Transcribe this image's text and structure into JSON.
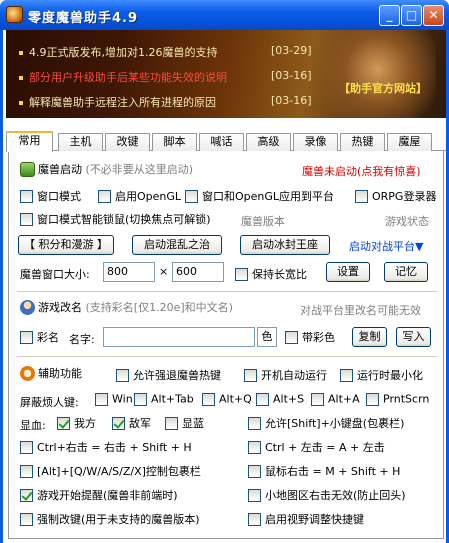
{
  "window": {
    "title": "零度魔兽助手4.9"
  },
  "banner": {
    "news": [
      {
        "text": "4.9正式版发布,增加对1.26魔兽的支持",
        "date": "[03-29]"
      },
      {
        "text": "部分用户升级助手后某些功能失效的说明",
        "date": "[03-16]"
      },
      {
        "text": "解释魔兽助手远程注入所有进程的原因",
        "date": "[03-16]"
      }
    ],
    "official_link": "【助手官方网站】"
  },
  "tabs": [
    "常用",
    "主机",
    "改键",
    "脚本",
    "喊话",
    "高级",
    "录像",
    "热键",
    "魔屋"
  ],
  "warcraft": {
    "section_title": "魔兽启动",
    "section_hint": "(不必非要从这里启动)",
    "status": "魔兽未启动(点我有惊喜)",
    "window_mode": "窗口模式",
    "opengl": "启用OpenGL",
    "window_opengl_platform": "窗口和OpenGL应用到平台",
    "orpg": "ORPG登录器",
    "smart_lock": "窗口模式智能锁鼠(切换焦点可解锁)",
    "version_label": "魔兽版本",
    "game_status_label": "游戏状态",
    "btn_ladder": "【 积分和漫游 】",
    "btn_roc": "启动混乱之治",
    "btn_tft": "启动冰封王座",
    "btn_platform": "启动对战平台▼",
    "size_label": "魔兽窗口大小:",
    "width": "800",
    "times": "×",
    "height": "600",
    "keep_ratio": "保持长宽比",
    "btn_set": "设置",
    "btn_remember": "记忆"
  },
  "rename": {
    "section_title": "游戏改名",
    "section_hint": "(支持彩名[仅1.20e]和中文名)",
    "right_hint": "对战平台里改名可能无效",
    "color_name": "彩名",
    "name_label": "名字:",
    "name_value": "",
    "color_btn": "色",
    "with_color": "带彩色",
    "btn_copy": "复制",
    "btn_write": "写入"
  },
  "aux": {
    "section_title": "辅助功能",
    "allow_hotkey": "允许强退魔兽热键",
    "auto_run": "开机自动运行",
    "minimize": "运行时最小化",
    "shield_keys_label": "屏蔽烦人键:",
    "shield_keys": [
      "Win",
      "Alt+Tab",
      "Alt+Q",
      "Alt+S",
      "Alt+A",
      "PrntScrn"
    ],
    "show_label": "显血:",
    "own": "我方",
    "enemy": "敌军",
    "show_blue": "显蓝",
    "allow_shift": "允许[Shift]+小键盘(包裹栏)",
    "ctrl_right": "Ctrl+右击 = 右击 + Shift + H",
    "ctrl_left": "Ctrl + 左击 = A + 左击",
    "alt_keys": "[Alt]+[Q/W/A/S/Z/X]控制包裹栏",
    "mouse_right": "鼠标右击 = M + Shift + H",
    "game_start_remind": "游戏开始提醒(魔兽非前端时)",
    "minimap_right": "小地图区右击无效(防止回头)",
    "force_key": "强制改键(用于未支持的魔兽版本)",
    "view_shortcut": "启用视野调整快捷键"
  }
}
